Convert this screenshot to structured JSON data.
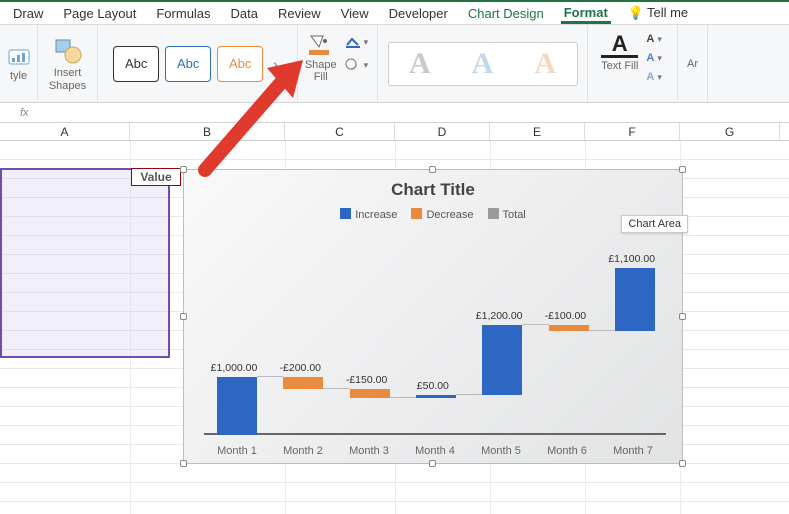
{
  "tabs": {
    "draw": "Draw",
    "page_layout": "Page Layout",
    "formulas": "Formulas",
    "data": "Data",
    "review": "Review",
    "view": "View",
    "developer": "Developer",
    "chart_design": "Chart Design",
    "format": "Format",
    "tell_me": "Tell me"
  },
  "ribbon": {
    "style_label": "tyle",
    "insert_shapes": "Insert\nShapes",
    "shape_style_abc": "Abc",
    "shape_fill": "Shape\nFill",
    "text_fill": "Text Fill",
    "ar": "Ar",
    "wordart_A": "A"
  },
  "formula_bar": {
    "fx": "fx"
  },
  "columns": {
    "A": "A",
    "B": "B",
    "C": "C",
    "D": "D",
    "E": "E",
    "F": "F",
    "G": "G"
  },
  "sheet": {
    "value_header": "Value"
  },
  "chart": {
    "title": "Chart Title",
    "tooltip": "Chart Area",
    "legend": {
      "increase": "Increase",
      "decrease": "Decrease",
      "total": "Total"
    }
  },
  "chart_data": {
    "type": "waterfall",
    "title": "Chart Title",
    "categories": [
      "Month 1",
      "Month 2",
      "Month 3",
      "Month 4",
      "Month 5",
      "Month 6",
      "Month 7"
    ],
    "series": [
      {
        "name": "Value",
        "values": [
          1000.0,
          -200.0,
          -150.0,
          50.0,
          1200.0,
          -100.0,
          1100.0
        ]
      }
    ],
    "data_labels": [
      "£1,000.00",
      "-£200.00",
      "-£150.00",
      "£50.00",
      "£1,200.00",
      "-£100.00",
      "£1,100.00"
    ],
    "legend_entries": [
      "Increase",
      "Decrease",
      "Total"
    ],
    "colors": {
      "increase": "#2e66c4",
      "decrease": "#e88b3f",
      "total": "#9a9a9a"
    },
    "ylim": [
      0,
      3000
    ],
    "xlabel": "",
    "ylabel": ""
  }
}
